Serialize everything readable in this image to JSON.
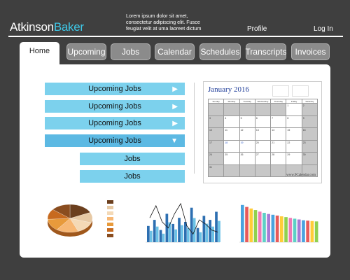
{
  "header": {
    "brand_first": "Atkinson",
    "brand_second": "Baker",
    "tagline": "Lorem ipsum dolor sit amet, consectetur adipiscing elit. Fusce feugiat velit at uma laoreet dictum",
    "profile_label": "Profile",
    "login_label": "Log In"
  },
  "tabs": [
    "Home",
    "Upcoming",
    "Jobs",
    "Calendar",
    "Schedules",
    "Transcripts",
    "Invoices"
  ],
  "list_buttons": [
    "Upcoming Jobs",
    "Upcoming Jobs",
    "Upcoming Jobs",
    "Upcoming Jobs"
  ],
  "sub_buttons": [
    "Jobs",
    "Jobs"
  ],
  "calendar": {
    "month": "January",
    "year": "2016",
    "weekdays": [
      "Sunday",
      "Monday",
      "Tuesday",
      "Wednesday",
      "Thursday",
      "Friday",
      "Saturday"
    ],
    "days": [
      "",
      "",
      "",
      "",
      "",
      "1",
      "2",
      "3",
      "4",
      "5",
      "6",
      "7",
      "8",
      "9",
      "10",
      "11",
      "12",
      "13",
      "14",
      "15",
      "16",
      "17",
      "18",
      "19",
      "20",
      "21",
      "22",
      "23",
      "24",
      "25",
      "26",
      "27",
      "28",
      "29",
      "30",
      "31",
      "",
      "",
      "",
      "",
      "",
      ""
    ],
    "footer": "www.9Calendar.com"
  },
  "colors": {
    "background": "#3f3f3f",
    "accent": "#3ec7e6",
    "button": "#7cd1ed",
    "tab": "#8b8b8b"
  },
  "chart_data": [
    {
      "type": "pie",
      "values": [
        18,
        12,
        14,
        16,
        14,
        12,
        14
      ],
      "legend": [
        "",
        "",
        "",
        "",
        "",
        "",
        ""
      ],
      "colors": [
        "#6b3f1e",
        "#e7c9a4",
        "#f4d9b6",
        "#f7b774",
        "#e89a3b",
        "#c76a1f",
        "#8a4d1f"
      ]
    },
    {
      "type": "bar",
      "values": [
        40,
        55,
        30,
        70,
        45,
        60,
        50,
        85,
        35,
        65,
        55,
        75
      ],
      "line": [
        60,
        90,
        50,
        35,
        70,
        95,
        40,
        20,
        55,
        45,
        30,
        25
      ],
      "colors": [
        "#2d6fb1",
        "#6cc2e6"
      ]
    },
    {
      "type": "bar",
      "values": [
        95,
        90,
        86,
        82,
        78,
        75,
        72,
        70,
        68,
        66,
        64,
        62,
        60,
        58,
        56,
        55,
        54,
        53
      ],
      "colors": [
        "#4aa3df",
        "#e85a5a",
        "#ffcd38",
        "#8fd14f",
        "#f07ab8",
        "#5dd0c6",
        "#a77ad6"
      ]
    }
  ]
}
